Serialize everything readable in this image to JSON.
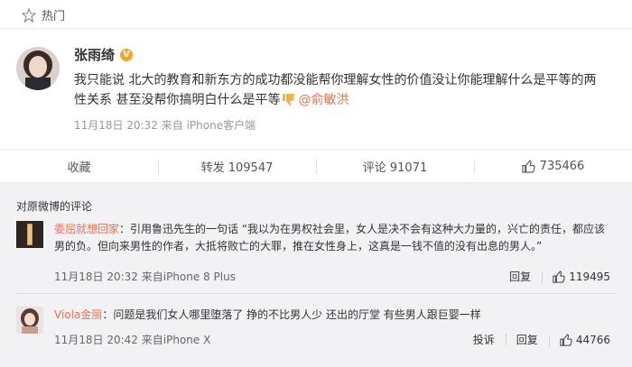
{
  "topbar": {
    "label": "热门"
  },
  "post": {
    "author": "张雨绮",
    "text_line1": "我只能说 北大的教育和新东方的成功都没能帮你理解女性的价值没让你能理解什么是平等的两",
    "text_line2": "性关系 甚至没帮你搞明白什么是平等",
    "mention": "@俞敏洪",
    "meta": "11月18日 20:32 来自 iPhone客户端"
  },
  "actions": {
    "favorite": "收藏",
    "repost": "转发 109547",
    "comment": "评论 91071",
    "like": "735466"
  },
  "comments_title": "对原微博的评论",
  "comments": [
    {
      "user": "委屈就想回家",
      "text": "：引用鲁迅先生的一句话 “我以为在男权社会里，女人是决不会有这种大力量的，兴亡的责任，都应该男的负。但向来男性的作者，大抵将败亡的大罪，推在女性身上，这真是一钱不值的没有出息的男人。”",
      "meta": "11月18日 20:32 来自iPhone 8 Plus",
      "reply": "回复",
      "likes": "119495"
    },
    {
      "user": "Viola金丽",
      "text": "：问题是我们女人哪里堕落了 挣的不比男人少 还出的厅堂 有些男人跟巨婴一样",
      "meta": "11月18日 20:42 来自iPhone X",
      "report": "投诉",
      "reply": "回复",
      "likes": "44766"
    }
  ],
  "colors": {
    "accent": "#eb7350",
    "badge": "#f5a623",
    "comments_bg": "#f2f2f5"
  },
  "icons": [
    "star-icon",
    "verified-badge-icon",
    "thumbs-down-emoji-icon",
    "thumbs-up-icon"
  ]
}
